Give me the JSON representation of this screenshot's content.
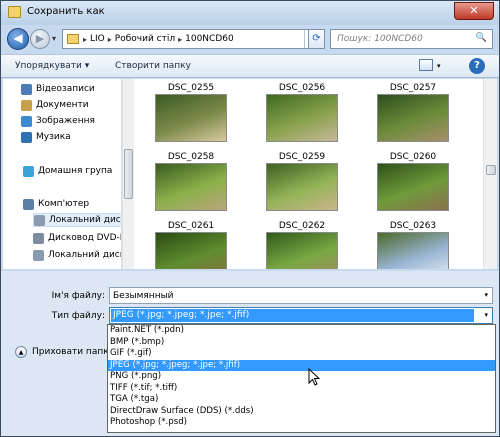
{
  "window": {
    "title": "Сохранить как",
    "close_glyph": "✕"
  },
  "nav": {
    "back_glyph": "◀",
    "forward_glyph": "▶",
    "dropdown_glyph": "▾",
    "breadcrumbs": [
      "LIO",
      "Робочий стіл",
      "100NCD60"
    ],
    "crumb_sep": "▸",
    "refresh_glyph": "⟳",
    "search_placeholder": "Пошук: 100NCD60",
    "search_icon": "🔍"
  },
  "toolbar": {
    "organize": "Упорядкувати ▾",
    "new_folder": "Створити папку",
    "help": "?"
  },
  "sidebar": {
    "items": [
      {
        "label": "Відеозаписи",
        "icon": "video-library-icon",
        "color": "#4a7ab8"
      },
      {
        "label": "Документи",
        "icon": "documents-library-icon",
        "color": "#c7a04a"
      },
      {
        "label": "Зображення",
        "icon": "pictures-library-icon",
        "color": "#3e8ad1"
      },
      {
        "label": "Музика",
        "icon": "music-library-icon",
        "color": "#2f6fb3"
      },
      {
        "label": "Домашня група",
        "icon": "homegroup-icon",
        "color": "#3aa3d8"
      },
      {
        "label": "Комп'ютер",
        "icon": "computer-icon",
        "color": "#5a7ea6"
      },
      {
        "label": "Локальний диск",
        "icon": "local-disk-icon",
        "color": "#8a9bb0"
      },
      {
        "label": "Дисковод DVD-R",
        "icon": "dvd-drive-icon",
        "color": "#7d8c9e"
      },
      {
        "label": "Локальний диск",
        "icon": "local-disk-icon",
        "color": "#8a9bb0"
      }
    ]
  },
  "files": [
    {
      "name": "DSC_0255",
      "palette": [
        "#3c5a22",
        "#7c8a4a",
        "#d8c9a0"
      ]
    },
    {
      "name": "DSC_0256",
      "palette": [
        "#3f6a22",
        "#8aa24c",
        "#c7b79b"
      ]
    },
    {
      "name": "DSC_0257",
      "palette": [
        "#2e4f1e",
        "#6c8c3a",
        "#a88f6d"
      ]
    },
    {
      "name": "DSC_0258",
      "palette": [
        "#3a5d1f",
        "#8bb04a",
        "#b9a57d"
      ]
    },
    {
      "name": "DSC_0259",
      "palette": [
        "#3e6121",
        "#94b357",
        "#c9b58c"
      ]
    },
    {
      "name": "DSC_0260",
      "palette": [
        "#2f5219",
        "#6f9a3a",
        "#8c7150"
      ]
    },
    {
      "name": "DSC_0261",
      "palette": [
        "#2b4c16",
        "#5f8d2e",
        "#8a6f45"
      ]
    },
    {
      "name": "DSC_0262",
      "palette": [
        "#315a1c",
        "#79a843",
        "#a48a63"
      ]
    },
    {
      "name": "DSC_0263",
      "palette": [
        "#4c6a2a",
        "#9ab5d4",
        "#e8eef5"
      ]
    }
  ],
  "form": {
    "filename_label": "Ім'я файлу:",
    "filename_value": "Безымянный",
    "filetype_label": "Тип файлу:",
    "filetype_value": "JPEG (*.jpg; *.jpeg; *.jpe; *.jfif)",
    "hide_folders": "Приховати папки",
    "arrow": "▾",
    "circle_glyph": "▲"
  },
  "filetype_options": [
    "Paint.NET (*.pdn)",
    "BMP (*.bmp)",
    "GIF (*.gif)",
    "JPEG (*.jpg; *.jpeg; *.jpe; *.jfif)",
    "PNG (*.png)",
    "TIFF (*.tif; *.tiff)",
    "TGA (*.tga)",
    "DirectDraw Surface (DDS) (*.dds)",
    "Photoshop (*.psd)"
  ],
  "selected_filetype_index": 3
}
